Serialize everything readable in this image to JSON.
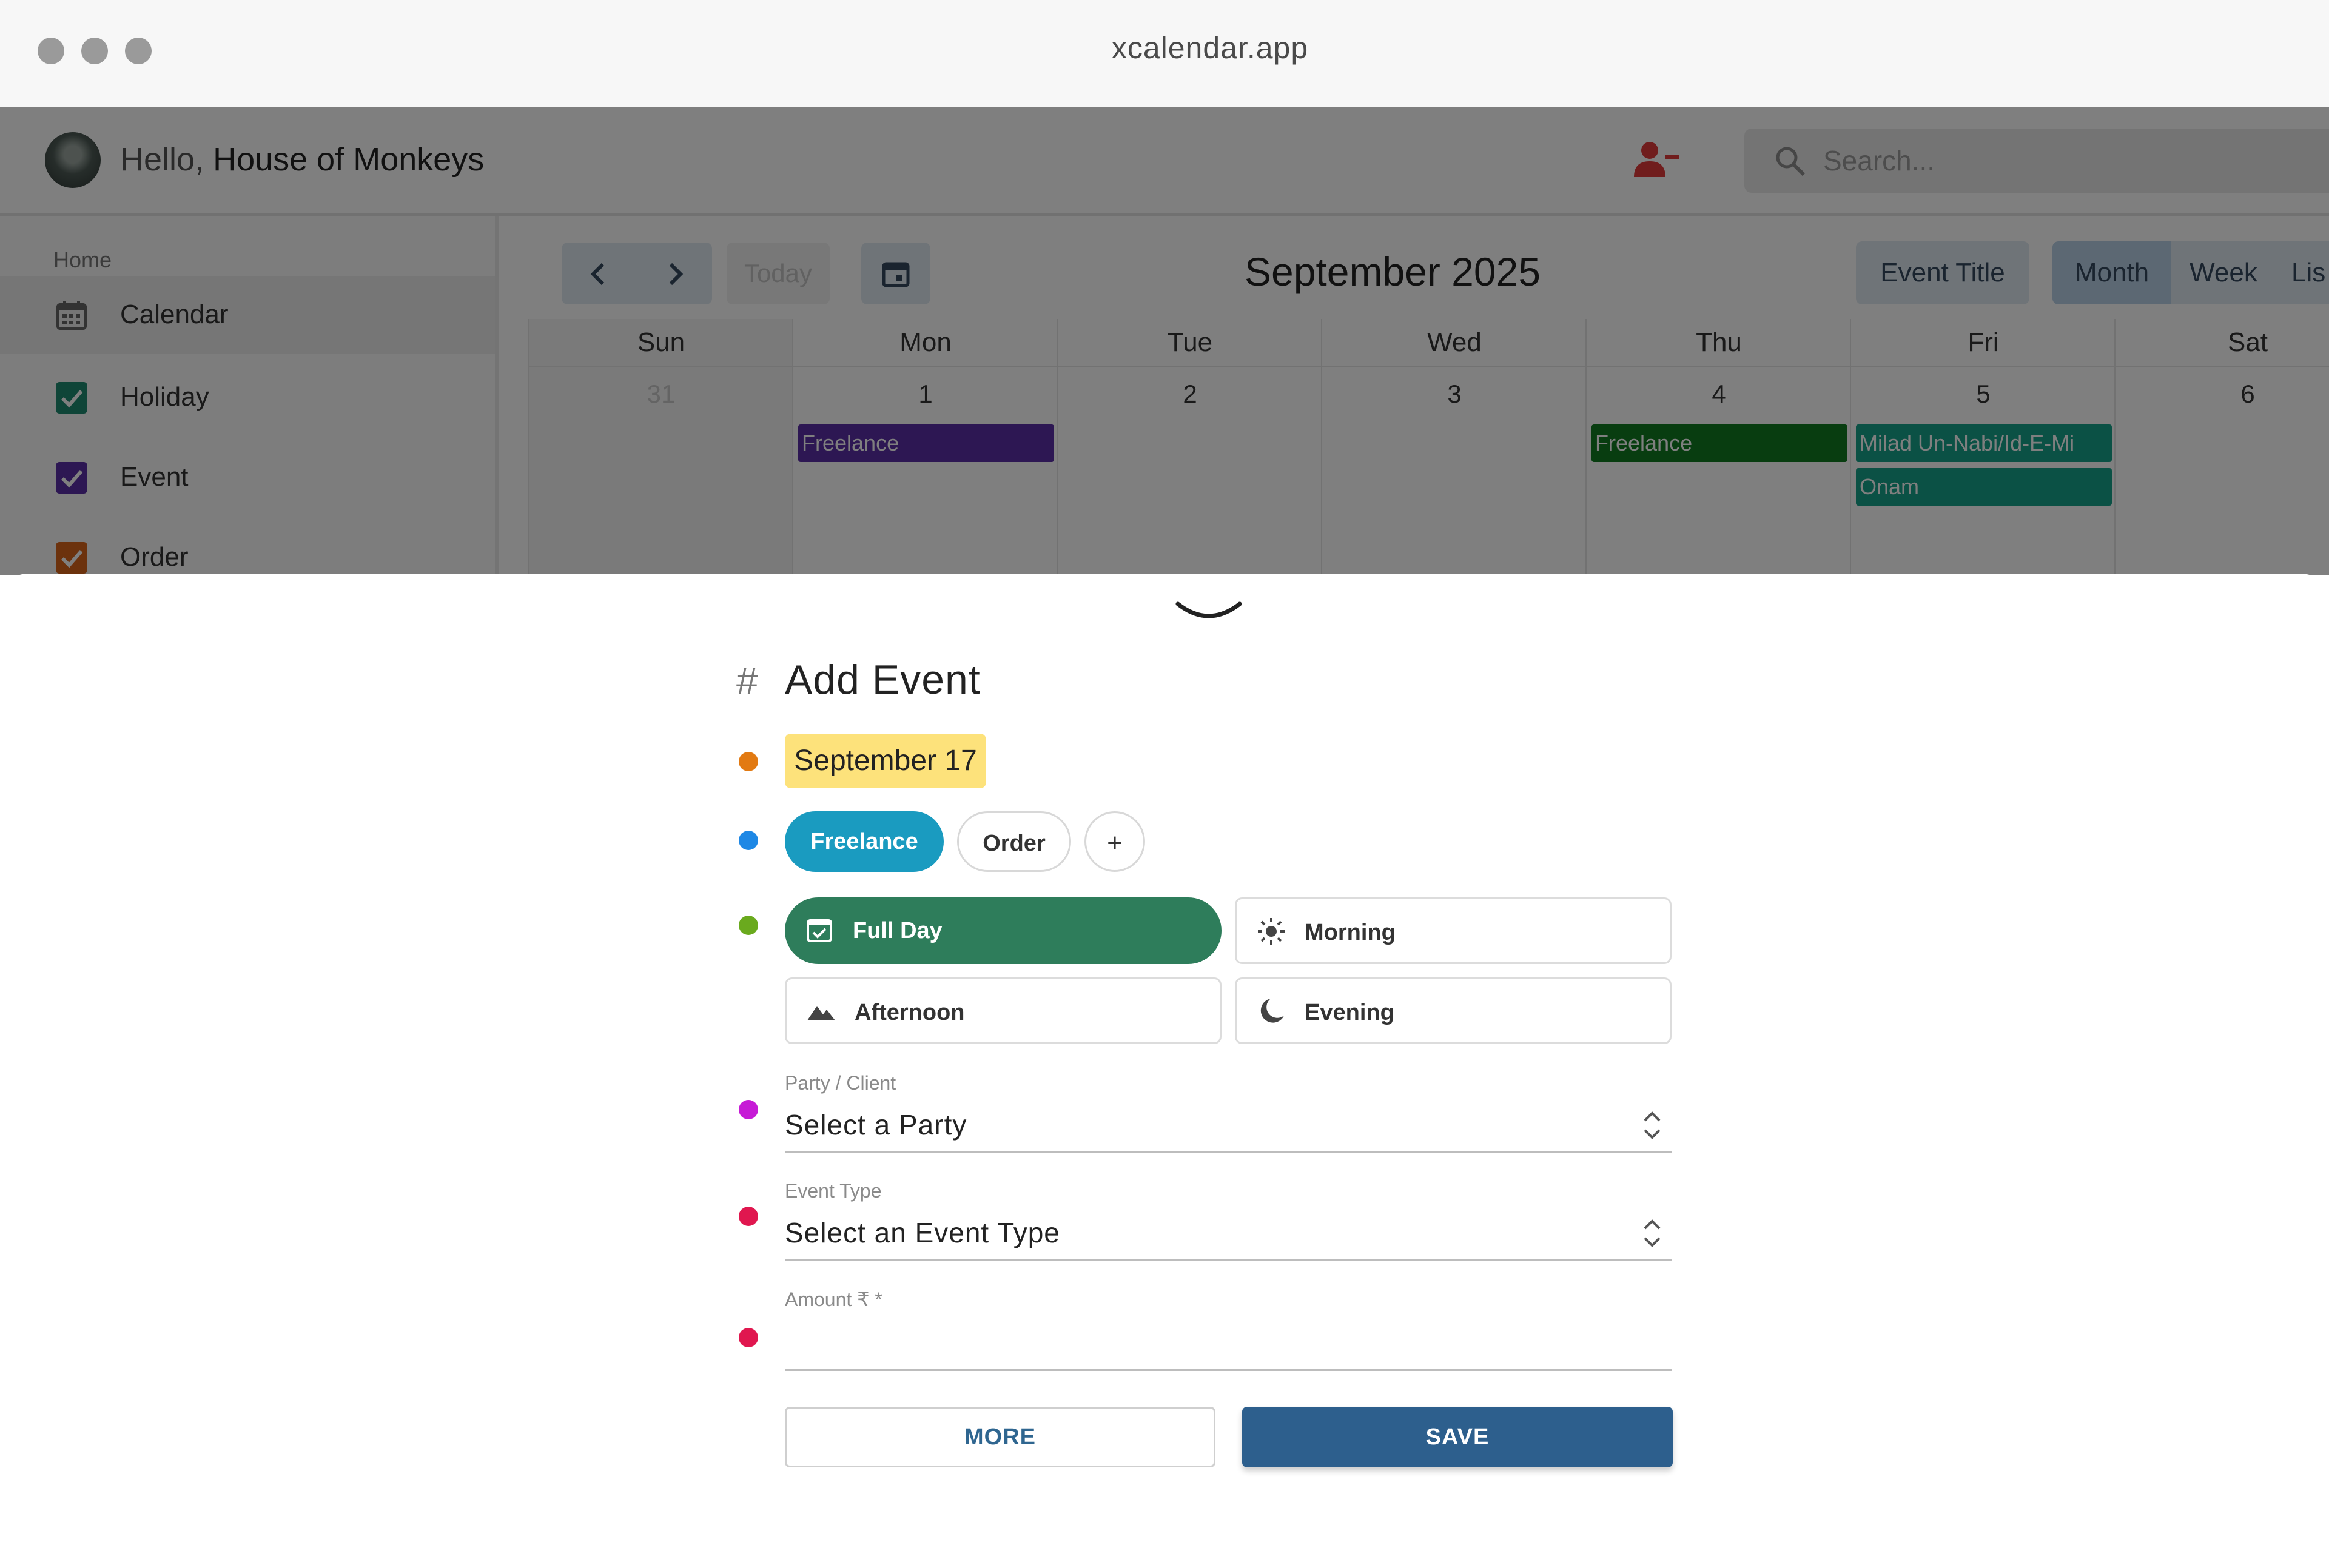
{
  "window": {
    "title": "xcalendar.app"
  },
  "header": {
    "greeting": "Hello,",
    "user_name": "House of Monkeys",
    "search_placeholder": "Search..."
  },
  "sidebar": {
    "section": "Home",
    "items": [
      {
        "label": "Calendar",
        "icon": "calendar-icon"
      },
      {
        "label": "Holiday",
        "icon": "checkbox-icon",
        "color": "#1f8a70",
        "checked": true
      },
      {
        "label": "Event",
        "icon": "checkbox-icon",
        "color": "#5b2fa6",
        "checked": true
      },
      {
        "label": "Order",
        "icon": "checkbox-icon",
        "color": "#d9651b",
        "checked": true
      }
    ]
  },
  "calendar": {
    "today_label": "Today",
    "title": "September 2025",
    "event_title_button": "Event Title",
    "views": [
      "Month",
      "Week",
      "Lis"
    ],
    "active_view": "Month",
    "days": [
      "Sun",
      "Mon",
      "Tue",
      "Wed",
      "Thu",
      "Fri",
      "Sat"
    ],
    "dates": [
      "31",
      "1",
      "2",
      "3",
      "4",
      "5",
      "6"
    ],
    "events": [
      {
        "label": "Freelance",
        "day": "Mon",
        "color": "#5b2fa6"
      },
      {
        "label": "Freelance",
        "day": "Thu",
        "color": "#117a21"
      },
      {
        "label": "Milad Un-Nabi/Id-E-Mi",
        "day": "Fri",
        "color": "#17a38a"
      },
      {
        "label": "Onam",
        "day": "Fri",
        "color": "#17a38a"
      }
    ]
  },
  "add_event": {
    "heading_symbol": "#",
    "heading": "Add Event",
    "date": "September 17",
    "categories": [
      "Freelance",
      "Order"
    ],
    "selected_category": "Freelance",
    "add_category": "+",
    "time_slots": [
      "Full Day",
      "Morning",
      "Afternoon",
      "Evening"
    ],
    "selected_slot": "Full Day",
    "party": {
      "label": "Party / Client",
      "value": "Select a Party"
    },
    "event_type": {
      "label": "Event Type",
      "value": "Select an Event Type"
    },
    "amount": {
      "label": "Amount ₹ *",
      "value": ""
    },
    "more_button": "MORE",
    "save_button": "SAVE",
    "dot_colors": [
      "#e27a12",
      "#1e88e5",
      "#6aaa1e",
      "#c61bd6",
      "#e0174f",
      "#e0174f"
    ]
  }
}
